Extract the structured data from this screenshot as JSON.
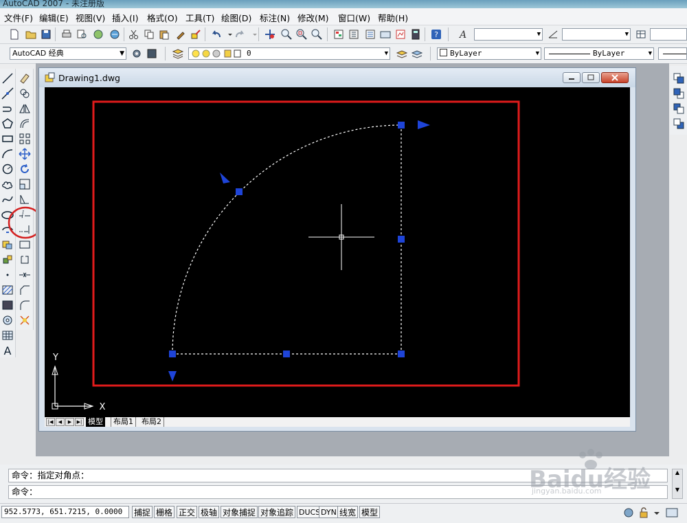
{
  "app": {
    "title": "AutoCAD 2007 - 未注册版"
  },
  "menu": [
    "文件(F)",
    "编辑(E)",
    "视图(V)",
    "插入(I)",
    "格式(O)",
    "工具(T)",
    "绘图(D)",
    "标注(N)",
    "修改(M)",
    "窗口(W)",
    "帮助(H)"
  ],
  "toolbar2": {
    "workspace": "AutoCAD 经典",
    "layer": "0",
    "color": "ByLayer",
    "linetype": "ByLayer"
  },
  "document": {
    "title": "Drawing1.dwg"
  },
  "ucs": {
    "x_label": "X",
    "y_label": "Y"
  },
  "layout_tabs": [
    "模型",
    "布局1",
    "布局2"
  ],
  "command": {
    "history": "命令：指定对角点：",
    "prompt": "命令："
  },
  "status": {
    "coords": "952.5773, 651.7215, 0.0000",
    "toggles": [
      "捕捉",
      "栅格",
      "正交",
      "极轴",
      "对象捕捉",
      "对象追踪",
      "DUCS",
      "DYN",
      "线宽",
      "模型"
    ]
  },
  "watermark": {
    "logo": "Baidu经验",
    "url": "jingyan.baidu.com"
  },
  "colors": {
    "highlight": "#e01b1b",
    "grip": "#1e44d8",
    "canvas": "#000000"
  }
}
